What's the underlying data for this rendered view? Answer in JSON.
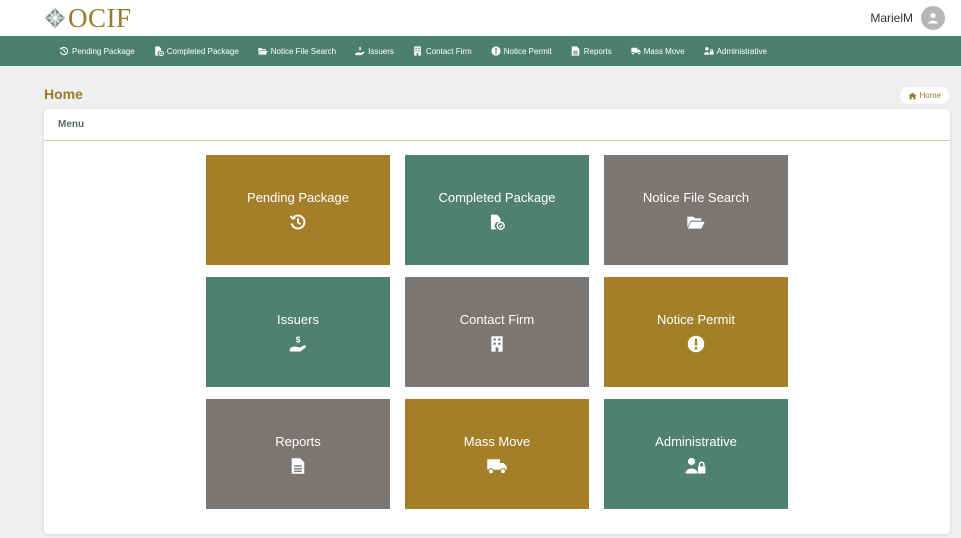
{
  "brand": {
    "logo_text": "OCIF"
  },
  "user": {
    "name": "MarielM"
  },
  "nav": [
    {
      "label": "Pending Package",
      "icon": "history-icon"
    },
    {
      "label": "Completed Package",
      "icon": "file-check-icon"
    },
    {
      "label": "Notice File Search",
      "icon": "folder-open-icon"
    },
    {
      "label": "Issuers",
      "icon": "hand-dollar-icon"
    },
    {
      "label": "Contact Firm",
      "icon": "building-icon"
    },
    {
      "label": "Notice Permit",
      "icon": "exclamation-circle-icon"
    },
    {
      "label": "Reports",
      "icon": "file-text-icon"
    },
    {
      "label": "Mass Move",
      "icon": "truck-icon"
    },
    {
      "label": "Administrative",
      "icon": "users-lock-icon"
    }
  ],
  "page": {
    "title": "Home",
    "breadcrumb": "Home"
  },
  "panel": {
    "title": "Menu"
  },
  "tiles": [
    {
      "label": "Pending Package",
      "icon": "history-icon",
      "color": "#a37f29"
    },
    {
      "label": "Completed Package",
      "icon": "file-check-icon",
      "color": "#4f8070"
    },
    {
      "label": "Notice File Search",
      "icon": "folder-open-icon",
      "color": "#7a7674"
    },
    {
      "label": "Issuers",
      "icon": "hand-dollar-icon",
      "color": "#4f8070"
    },
    {
      "label": "Contact Firm",
      "icon": "building-icon",
      "color": "#7a7674"
    },
    {
      "label": "Notice Permit",
      "icon": "exclamation-circle-icon",
      "color": "#a37f29"
    },
    {
      "label": "Reports",
      "icon": "file-text-icon",
      "color": "#7a7674"
    },
    {
      "label": "Mass Move",
      "icon": "truck-icon",
      "color": "#a37f29"
    },
    {
      "label": "Administrative",
      "icon": "users-lock-icon",
      "color": "#4f8070"
    }
  ],
  "colors": {
    "gold": "#a37f29",
    "green": "#4f8070",
    "grey": "#7a7674",
    "navbar": "#4d7f6f"
  }
}
